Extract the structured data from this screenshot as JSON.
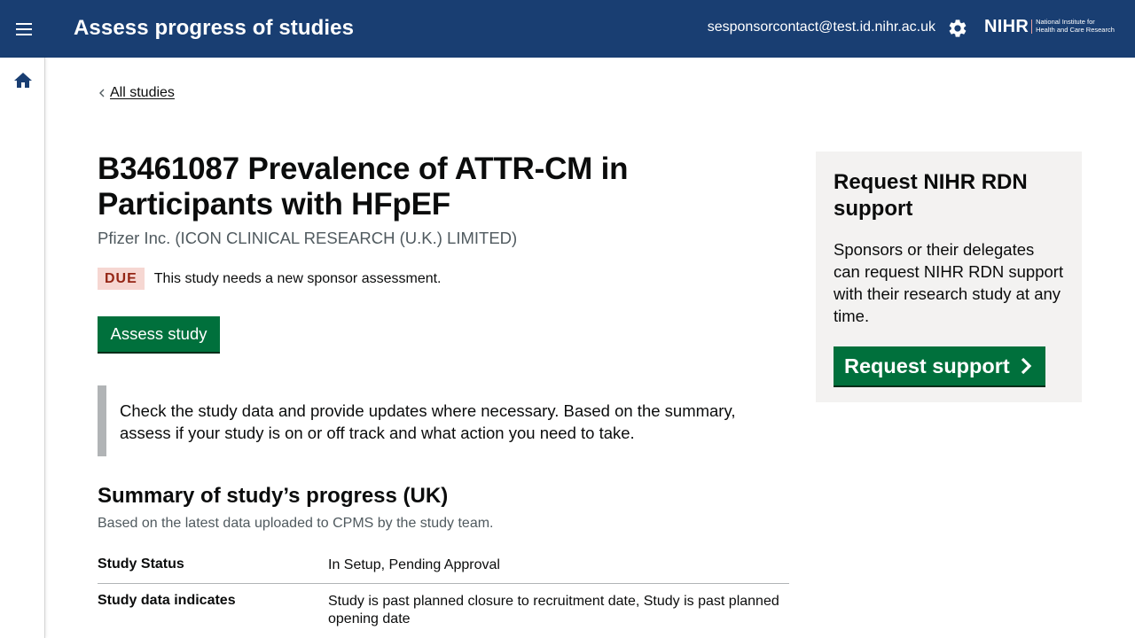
{
  "header": {
    "title": "Assess progress of studies",
    "user_email": "sesponsorcontact@test.id.nihr.ac.uk",
    "brand_mark": "NIHR",
    "brand_line1": "National Institute for",
    "brand_line2": "Health and Care Research",
    "icons": {
      "menu": "menu-icon",
      "settings": "gear-icon"
    },
    "colors": {
      "bar": "#193e72"
    }
  },
  "sidebar": {
    "home_icon": "home-icon"
  },
  "breadcrumb": {
    "back_label": "All studies"
  },
  "study": {
    "title": "B3461087 Prevalence of ATTR-CM in Participants with HFpEF",
    "sponsor": "Pfizer Inc. (ICON CLINICAL RESEARCH (U.K.) LIMITED)",
    "status_tag": "DUE",
    "status_message": "This study needs a new sponsor assessment.",
    "assess_button": "Assess study",
    "inset_text": "Check the study data and provide updates where necessary. Based on the summary, assess if your study is on or off track and what action you need to take."
  },
  "summary": {
    "heading": "Summary of study’s progress (UK)",
    "subheading": "Based on the latest data uploaded to CPMS by the study team.",
    "rows": [
      {
        "key": "Study Status",
        "value": "In Setup, Pending Approval"
      },
      {
        "key": "Study data indicates",
        "value": "Study is past planned closure to recruitment date, Study is past planned opening date"
      }
    ]
  },
  "support_panel": {
    "heading": "Request NIHR RDN support",
    "body": "Sponsors or their delegates can request NIHR RDN support with their research study at any time.",
    "button": "Request support",
    "colors": {
      "button": "#00703c",
      "background": "#f3f2f1"
    }
  }
}
